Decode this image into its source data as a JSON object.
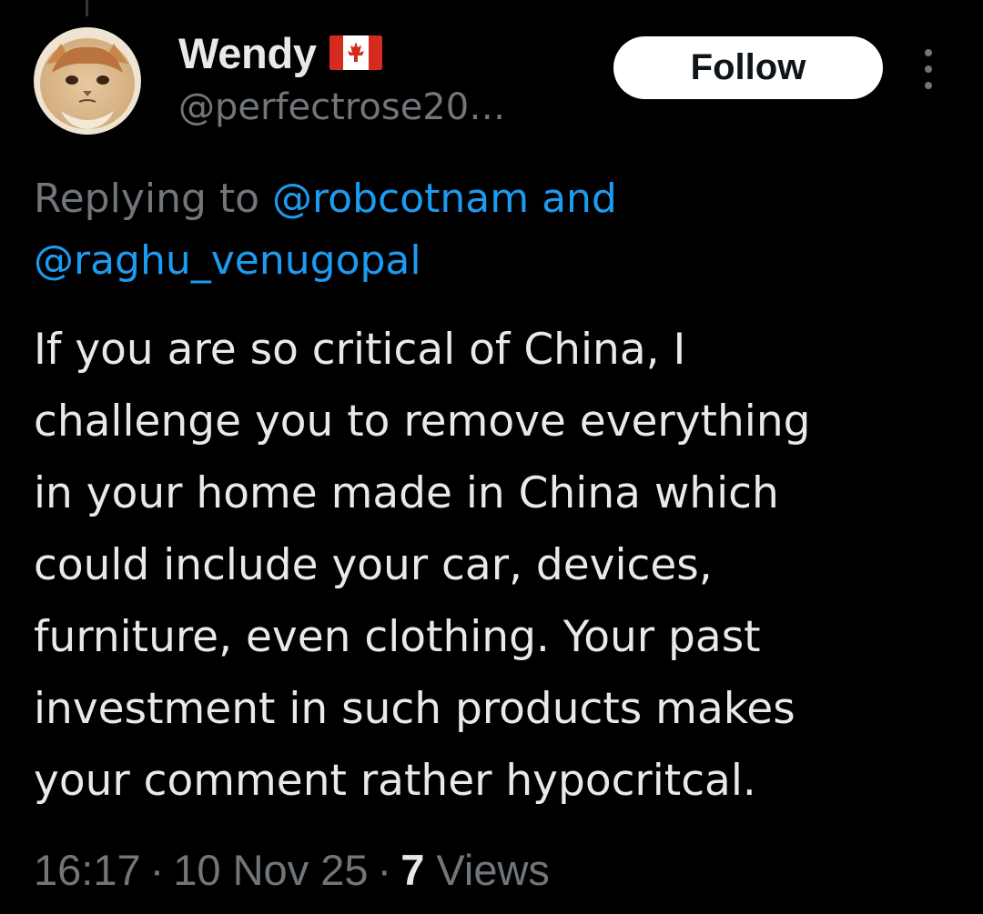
{
  "author": {
    "display_name": "Wendy",
    "flag_icon": "canada-flag-icon",
    "handle": "@perfectrose20…",
    "avatar_icon": "cat-avatar"
  },
  "follow_button": {
    "label": "Follow"
  },
  "more_menu": {
    "icon": "more-vertical-icon"
  },
  "reply_context": {
    "prefix": "Replying to ",
    "mentions": [
      "@robcotnam",
      "@raghu_venugopal"
    ],
    "conjunction": " and"
  },
  "tweet": {
    "text_lines": [
      "If you are so critical of China, I",
      "challenge you to remove everything",
      "in your home made in China which",
      "could include your car, devices,",
      "furniture, even clothing. Your past",
      "investment in such products makes",
      "your comment rather hypocritcal."
    ]
  },
  "meta": {
    "time": "16:17",
    "separator": "·",
    "date": "10 Nov 25",
    "views_count": "7",
    "views_label": "Views"
  },
  "colors": {
    "background": "#000000",
    "primary_text": "#e7e9ea",
    "secondary_text": "#71767b",
    "link": "#1d9bf0",
    "follow_bg": "#ffffff"
  }
}
